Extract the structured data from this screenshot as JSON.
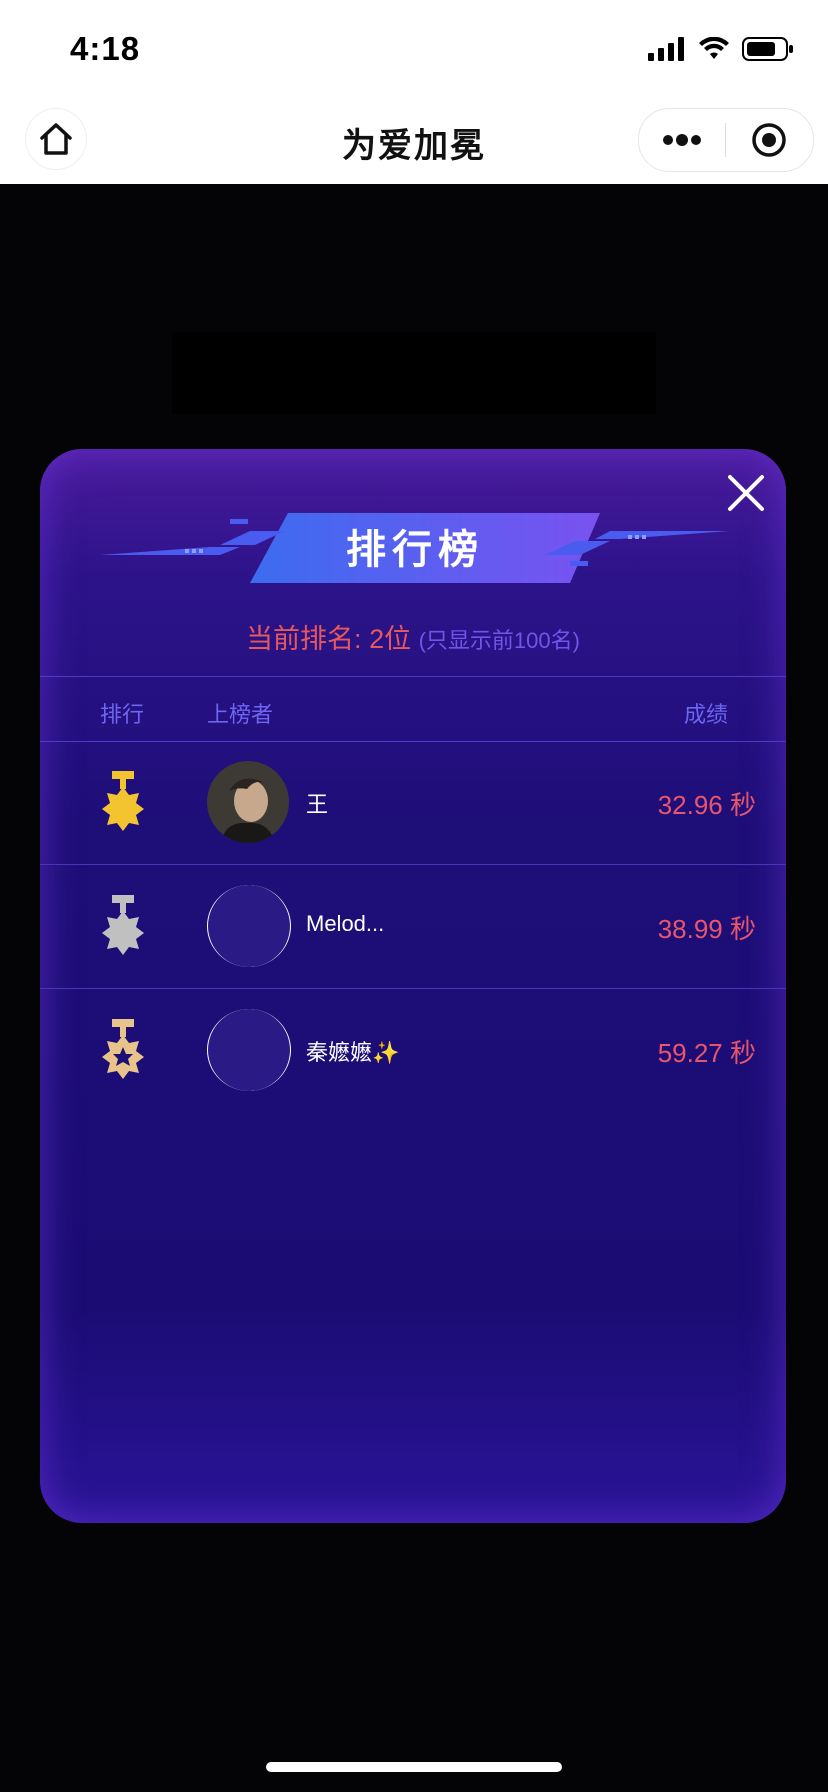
{
  "status_bar": {
    "time": "4:18"
  },
  "nav": {
    "title": "为爱加冕"
  },
  "leaderboard": {
    "title": "排行榜",
    "current_rank_label": "当前排名:",
    "current_rank_value": "2位",
    "note": "(只显示前100名)",
    "columns": {
      "rank": "排行",
      "player": "上榜者",
      "score": "成绩"
    },
    "rows": [
      {
        "medal": "gold-medal-icon",
        "name": "王",
        "score": "32.96 秒"
      },
      {
        "medal": "silver-medal-icon",
        "name": "Melod...",
        "score": "38.99 秒"
      },
      {
        "medal": "bronze-medal-icon",
        "name": "秦嬷嬷✨",
        "score": "59.27 秒"
      }
    ]
  },
  "colors": {
    "modal_bg": "#1e0e78",
    "score": "#e9556a",
    "rank_text": "#e6585e",
    "header_text": "#6d66f0",
    "gold": "#f4c430",
    "silver": "#c0c0c0",
    "bronze": "#e8c48a"
  }
}
